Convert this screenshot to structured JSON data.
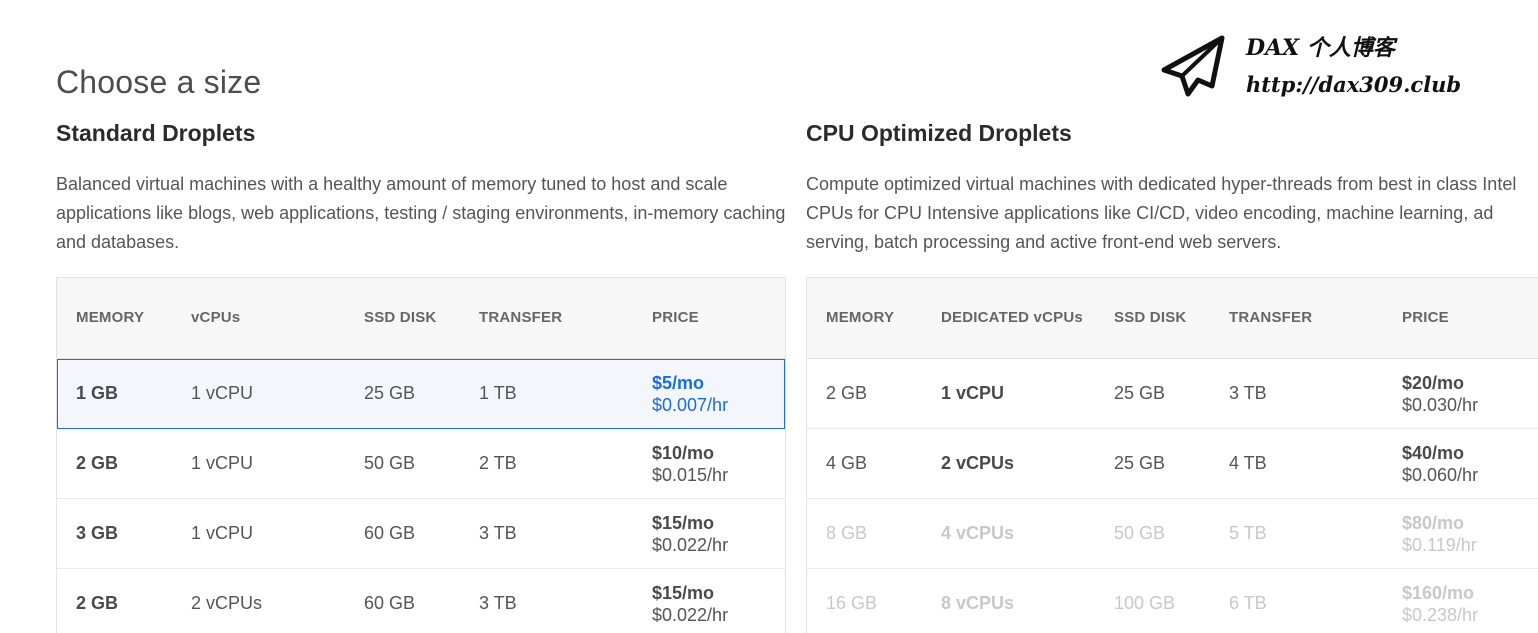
{
  "page_title": "Choose a size",
  "watermark": {
    "title": "DAX 个人博客",
    "url": "http://dax309.club",
    "icon": "paper-plane-icon"
  },
  "standard": {
    "title": "Standard Droplets",
    "description": "Balanced virtual machines with a healthy amount of memory tuned to host and scale applications like blogs, web applications, testing / staging environments, in-memory caching and databases.",
    "headers": {
      "memory": "MEMORY",
      "vcpus": "vCPUs",
      "disk": "SSD DISK",
      "transfer": "TRANSFER",
      "price": "PRICE"
    },
    "rows": [
      {
        "memory": "1 GB",
        "vcpus": "1 vCPU",
        "disk": "25 GB",
        "transfer": "1 TB",
        "monthly": "$5/mo",
        "hourly": "$0.007/hr",
        "selected": true
      },
      {
        "memory": "2 GB",
        "vcpus": "1 vCPU",
        "disk": "50 GB",
        "transfer": "2 TB",
        "monthly": "$10/mo",
        "hourly": "$0.015/hr",
        "selected": false
      },
      {
        "memory": "3 GB",
        "vcpus": "1 vCPU",
        "disk": "60 GB",
        "transfer": "3 TB",
        "monthly": "$15/mo",
        "hourly": "$0.022/hr",
        "selected": false
      },
      {
        "memory": "2 GB",
        "vcpus": "2 vCPUs",
        "disk": "60 GB",
        "transfer": "3 TB",
        "monthly": "$15/mo",
        "hourly": "$0.022/hr",
        "selected": false
      }
    ]
  },
  "cpu_optimized": {
    "title": "CPU Optimized Droplets",
    "description": "Compute optimized virtual machines with dedicated hyper-threads from best in class Intel CPUs for CPU Intensive applications like CI/CD, video encoding, machine learning, ad serving, batch processing and active front-end web servers.",
    "headers": {
      "memory": "MEMORY",
      "vcpus": "DEDICATED vCPUs",
      "disk": "SSD DISK",
      "transfer": "TRANSFER",
      "price": "PRICE"
    },
    "rows": [
      {
        "memory": "2 GB",
        "vcpus": "1 vCPU",
        "disk": "25 GB",
        "transfer": "3 TB",
        "monthly": "$20/mo",
        "hourly": "$0.030/hr",
        "disabled": false
      },
      {
        "memory": "4 GB",
        "vcpus": "2 vCPUs",
        "disk": "25 GB",
        "transfer": "4 TB",
        "monthly": "$40/mo",
        "hourly": "$0.060/hr",
        "disabled": false
      },
      {
        "memory": "8 GB",
        "vcpus": "4 vCPUs",
        "disk": "50 GB",
        "transfer": "5 TB",
        "monthly": "$80/mo",
        "hourly": "$0.119/hr",
        "disabled": true
      },
      {
        "memory": "16 GB",
        "vcpus": "8 vCPUs",
        "disk": "100 GB",
        "transfer": "6 TB",
        "monthly": "$160/mo",
        "hourly": "$0.238/hr",
        "disabled": true
      }
    ]
  },
  "colors": {
    "accent": "#1a6bdb",
    "selected_bg": "#f3f7fd",
    "disabled_text": "#c8c8c8",
    "header_bg": "#f7f7f7"
  }
}
